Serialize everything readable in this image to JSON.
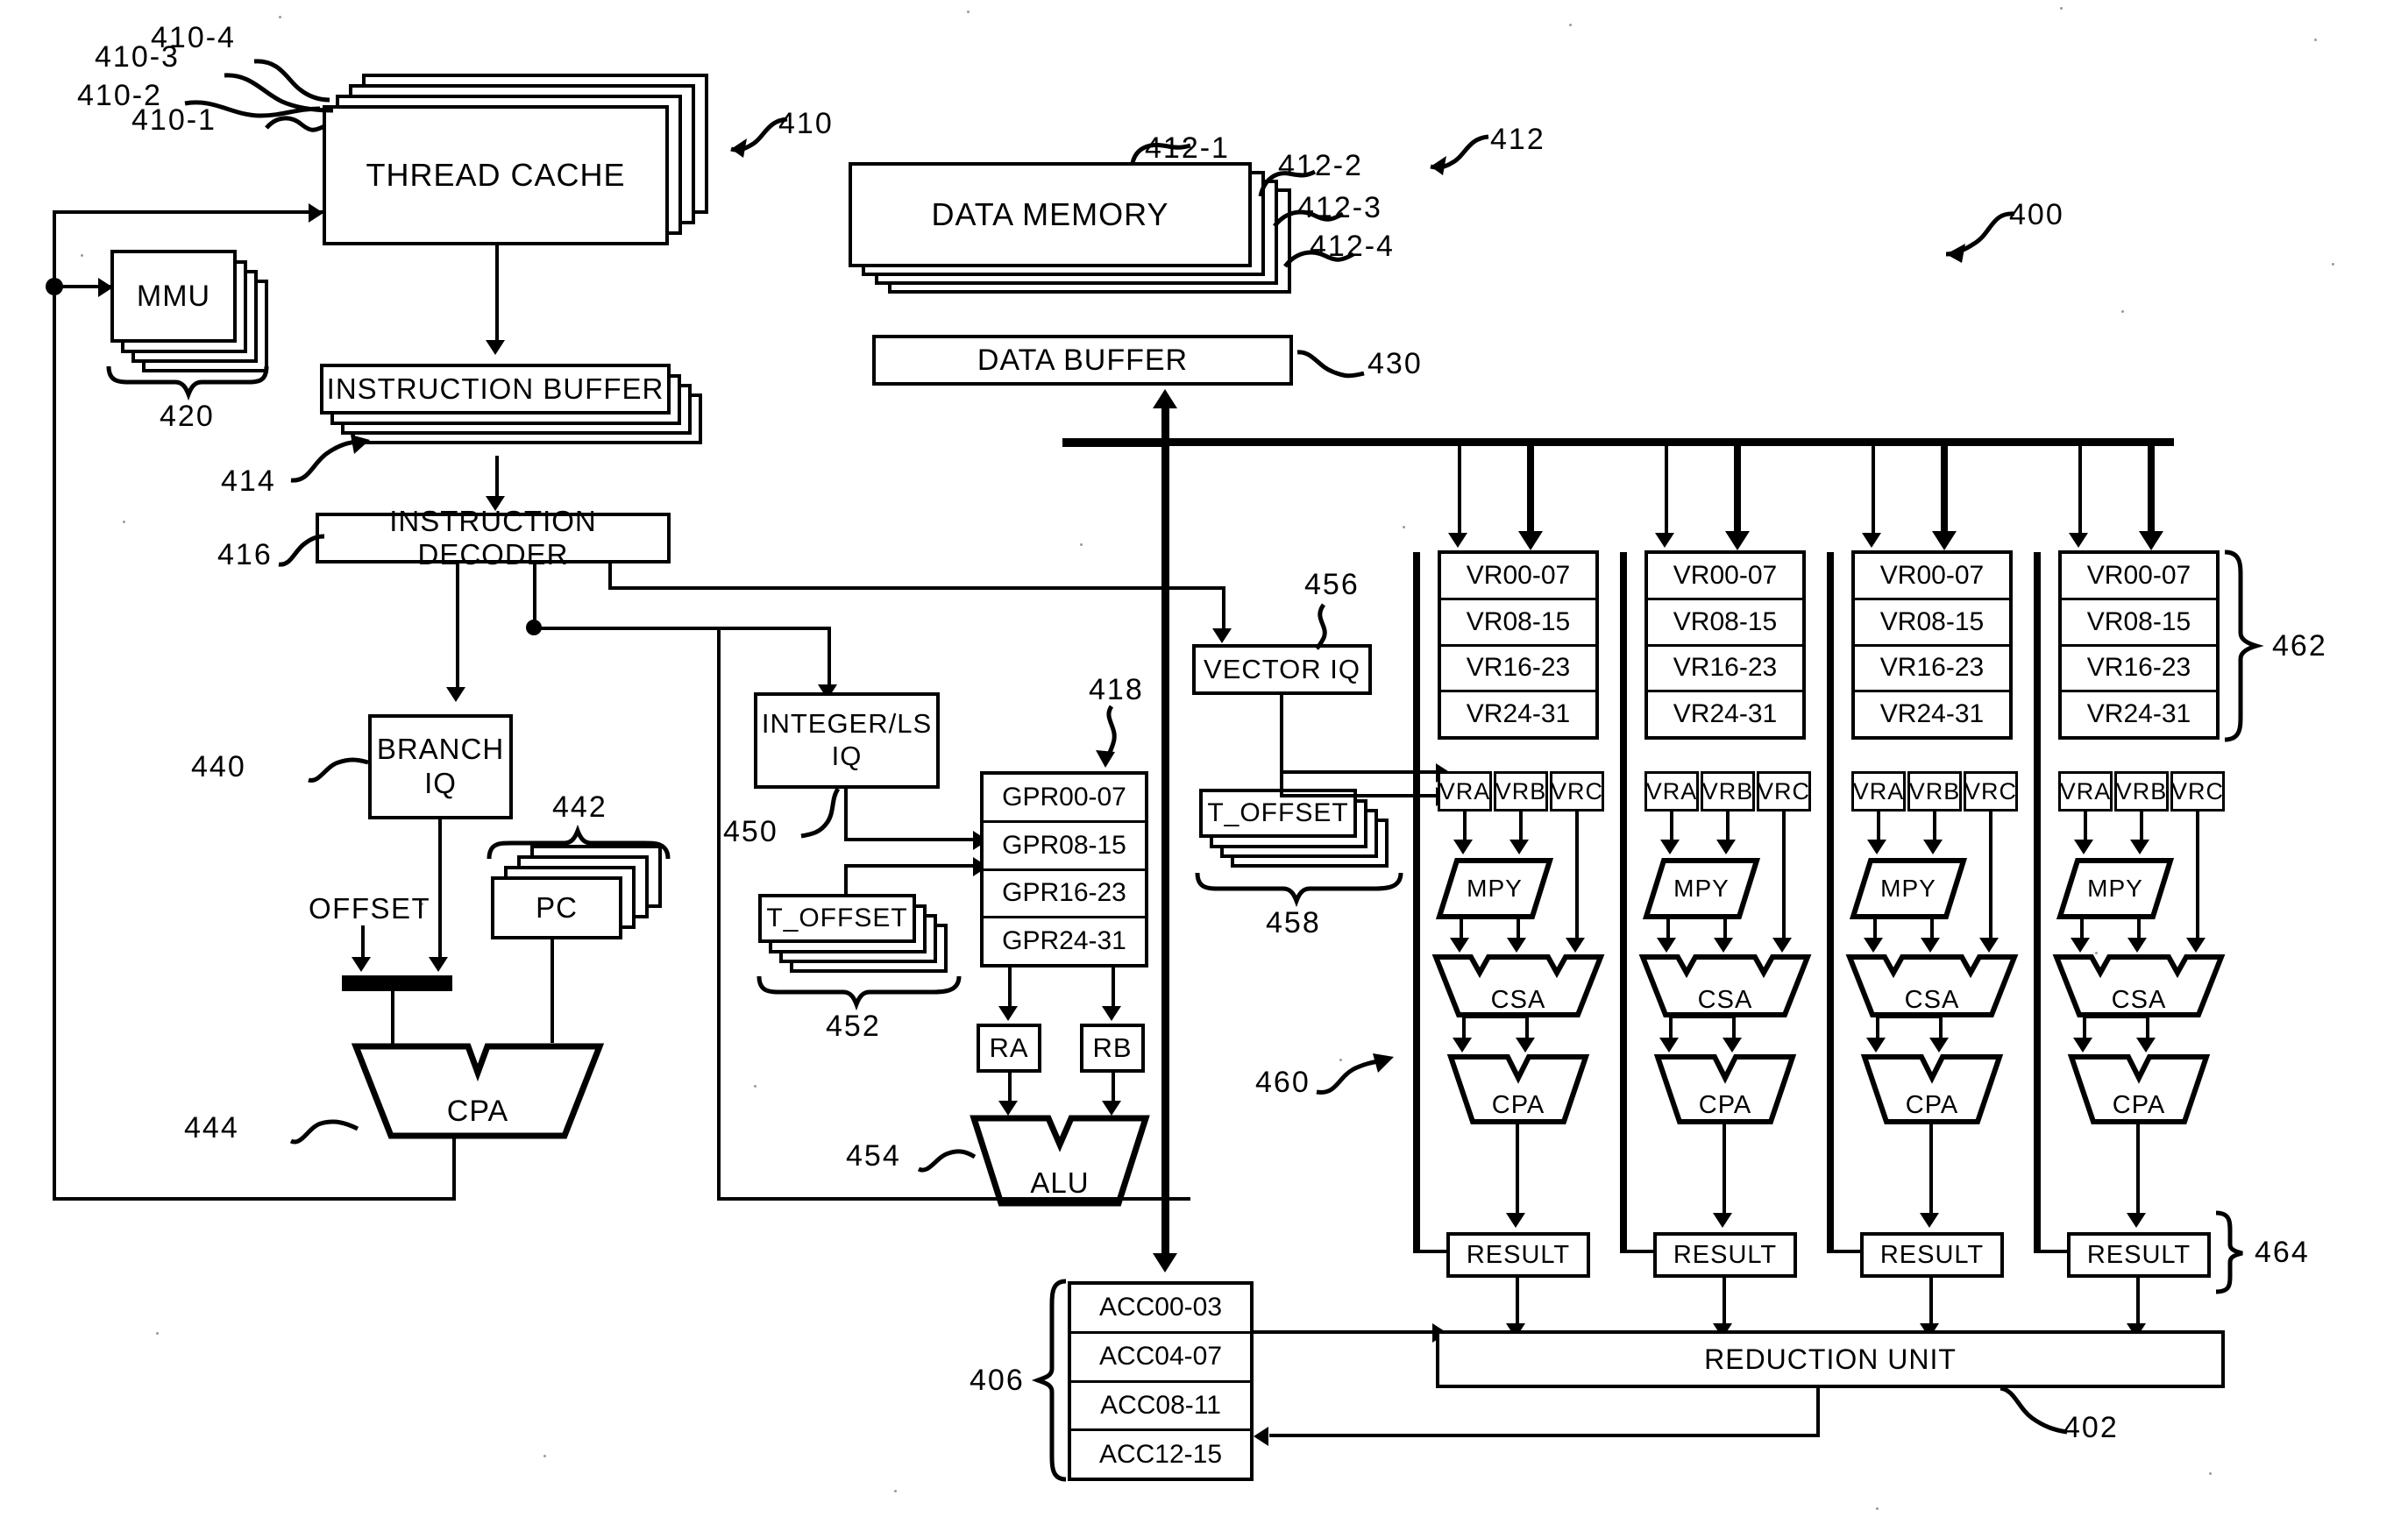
{
  "figure": {
    "id": "400",
    "ref_400": "400",
    "ref_402": "402",
    "ref_406": "406",
    "ref_410": "410",
    "ref_410_1": "410-1",
    "ref_410_2": "410-2",
    "ref_410_3": "410-3",
    "ref_410_4": "410-4",
    "ref_412": "412",
    "ref_412_1": "412-1",
    "ref_412_2": "412-2",
    "ref_412_3": "412-3",
    "ref_412_4": "412-4",
    "ref_414": "414",
    "ref_416": "416",
    "ref_418": "418",
    "ref_420": "420",
    "ref_430": "430",
    "ref_440": "440",
    "ref_442": "442",
    "ref_444": "444",
    "ref_450": "450",
    "ref_452": "452",
    "ref_454": "454",
    "ref_456": "456",
    "ref_458": "458",
    "ref_460": "460",
    "ref_462": "462",
    "ref_464": "464"
  },
  "blocks": {
    "thread_cache": "THREAD CACHE",
    "mmu": "MMU",
    "instruction_buffer": "INSTRUCTION BUFFER",
    "instruction_decoder": "INSTRUCTION  DECODER",
    "data_memory": "DATA MEMORY",
    "data_buffer": "DATA BUFFER",
    "branch_iq": "BRANCH\nIQ",
    "branch_iq_line1": "BRANCH",
    "branch_iq_line2": "IQ",
    "offset": "OFFSET",
    "pc": "PC",
    "cpa_branch": "CPA",
    "integer_ls_iq_line1": "INTEGER/LS",
    "integer_ls_iq_line2": "IQ",
    "t_offset": "T_OFFSET",
    "ra": "RA",
    "rb": "RB",
    "alu": "ALU",
    "vector_iq": "VECTOR IQ",
    "mpy": "MPY",
    "csa": "CSA",
    "cpa": "CPA",
    "result": "RESULT",
    "reduction_unit": "REDUCTION UNIT",
    "vra": "VRA",
    "vrb": "VRB",
    "vrc": "VRC"
  },
  "register_files": {
    "gpr": [
      "GPR00-07",
      "GPR08-15",
      "GPR16-23",
      "GPR24-31"
    ],
    "vr": [
      "VR00-07",
      "VR08-15",
      "VR16-23",
      "VR24-31"
    ],
    "acc": [
      "ACC00-03",
      "ACC04-07",
      "ACC08-11",
      "ACC12-15"
    ]
  },
  "lanes": [
    {
      "index": 1
    },
    {
      "index": 2
    },
    {
      "index": 3
    },
    {
      "index": 4
    }
  ],
  "colors": {
    "ink": "#000000",
    "paper": "#ffffff"
  }
}
